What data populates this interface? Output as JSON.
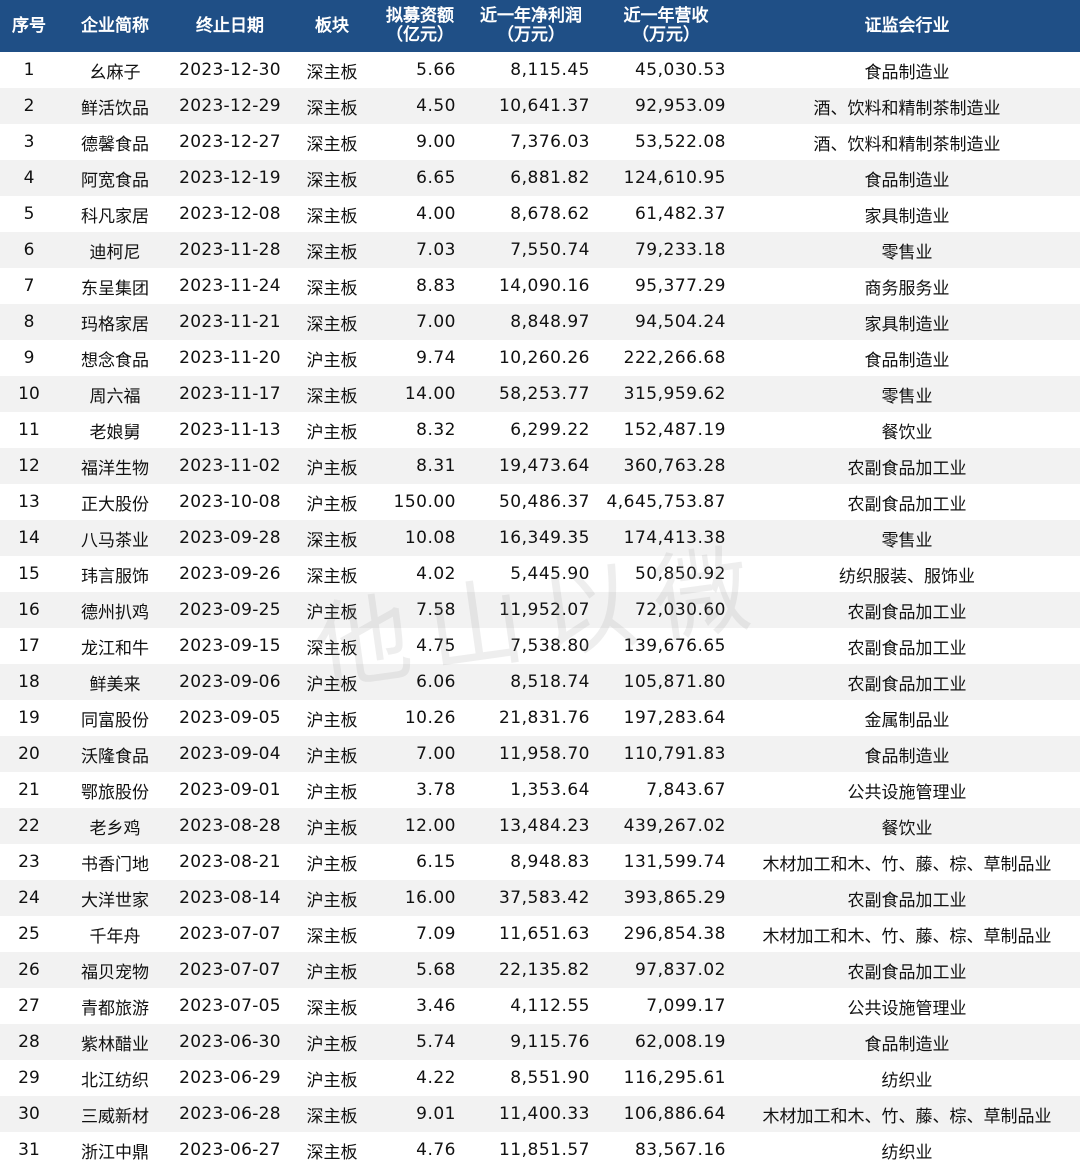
{
  "table": {
    "headers": [
      "序号",
      "企业简称",
      "终止日期",
      "板块",
      "拟募资额\n（亿元）",
      "近一年净利润\n（万元）",
      "近一年营收\n（万元）",
      "证监会行业"
    ],
    "rows": [
      [
        "1",
        "幺麻子",
        "2023-12-30",
        "深主板",
        "5.66",
        "8,115.45",
        "45,030.53",
        "食品制造业"
      ],
      [
        "2",
        "鲜活饮品",
        "2023-12-29",
        "深主板",
        "4.50",
        "10,641.37",
        "92,953.09",
        "酒、饮料和精制茶制造业"
      ],
      [
        "3",
        "德馨食品",
        "2023-12-27",
        "深主板",
        "9.00",
        "7,376.03",
        "53,522.08",
        "酒、饮料和精制茶制造业"
      ],
      [
        "4",
        "阿宽食品",
        "2023-12-19",
        "深主板",
        "6.65",
        "6,881.82",
        "124,610.95",
        "食品制造业"
      ],
      [
        "5",
        "科凡家居",
        "2023-12-08",
        "深主板",
        "4.00",
        "8,678.62",
        "61,482.37",
        "家具制造业"
      ],
      [
        "6",
        "迪柯尼",
        "2023-11-28",
        "深主板",
        "7.03",
        "7,550.74",
        "79,233.18",
        "零售业"
      ],
      [
        "7",
        "东呈集团",
        "2023-11-24",
        "深主板",
        "8.83",
        "14,090.16",
        "95,377.29",
        "商务服务业"
      ],
      [
        "8",
        "玛格家居",
        "2023-11-21",
        "深主板",
        "7.00",
        "8,848.97",
        "94,504.24",
        "家具制造业"
      ],
      [
        "9",
        "想念食品",
        "2023-11-20",
        "沪主板",
        "9.74",
        "10,260.26",
        "222,266.68",
        "食品制造业"
      ],
      [
        "10",
        "周六福",
        "2023-11-17",
        "深主板",
        "14.00",
        "58,253.77",
        "315,959.62",
        "零售业"
      ],
      [
        "11",
        "老娘舅",
        "2023-11-13",
        "沪主板",
        "8.32",
        "6,299.22",
        "152,487.19",
        "餐饮业"
      ],
      [
        "12",
        "福洋生物",
        "2023-11-02",
        "沪主板",
        "8.31",
        "19,473.64",
        "360,763.28",
        "农副食品加工业"
      ],
      [
        "13",
        "正大股份",
        "2023-10-08",
        "沪主板",
        "150.00",
        "50,486.37",
        "4,645,753.87",
        "农副食品加工业"
      ],
      [
        "14",
        "八马茶业",
        "2023-09-28",
        "深主板",
        "10.08",
        "16,349.35",
        "174,413.38",
        "零售业"
      ],
      [
        "15",
        "玮言服饰",
        "2023-09-26",
        "深主板",
        "4.02",
        "5,445.90",
        "50,850.92",
        "纺织服装、服饰业"
      ],
      [
        "16",
        "德州扒鸡",
        "2023-09-25",
        "沪主板",
        "7.58",
        "11,952.07",
        "72,030.60",
        "农副食品加工业"
      ],
      [
        "17",
        "龙江和牛",
        "2023-09-15",
        "深主板",
        "4.75",
        "7,538.80",
        "139,676.65",
        "农副食品加工业"
      ],
      [
        "18",
        "鲜美来",
        "2023-09-06",
        "沪主板",
        "6.06",
        "8,518.74",
        "105,871.80",
        "农副食品加工业"
      ],
      [
        "19",
        "同富股份",
        "2023-09-05",
        "沪主板",
        "10.26",
        "21,831.76",
        "197,283.64",
        "金属制品业"
      ],
      [
        "20",
        "沃隆食品",
        "2023-09-04",
        "沪主板",
        "7.00",
        "11,958.70",
        "110,791.83",
        "食品制造业"
      ],
      [
        "21",
        "鄂旅股份",
        "2023-09-01",
        "沪主板",
        "3.78",
        "1,353.64",
        "7,843.67",
        "公共设施管理业"
      ],
      [
        "22",
        "老乡鸡",
        "2023-08-28",
        "沪主板",
        "12.00",
        "13,484.23",
        "439,267.02",
        "餐饮业"
      ],
      [
        "23",
        "书香门地",
        "2023-08-21",
        "沪主板",
        "6.15",
        "8,948.83",
        "131,599.74",
        "木材加工和木、竹、藤、棕、草制品业"
      ],
      [
        "24",
        "大洋世家",
        "2023-08-14",
        "沪主板",
        "16.00",
        "37,583.42",
        "393,865.29",
        "农副食品加工业"
      ],
      [
        "25",
        "千年舟",
        "2023-07-07",
        "深主板",
        "7.09",
        "11,651.63",
        "296,854.38",
        "木材加工和木、竹、藤、棕、草制品业"
      ],
      [
        "26",
        "福贝宠物",
        "2023-07-07",
        "沪主板",
        "5.68",
        "22,135.82",
        "97,837.02",
        "农副食品加工业"
      ],
      [
        "27",
        "青都旅游",
        "2023-07-05",
        "深主板",
        "3.46",
        "4,112.55",
        "7,099.17",
        "公共设施管理业"
      ],
      [
        "28",
        "紫林醋业",
        "2023-06-30",
        "沪主板",
        "5.74",
        "9,115.76",
        "62,008.19",
        "食品制造业"
      ],
      [
        "29",
        "北江纺织",
        "2023-06-29",
        "沪主板",
        "4.22",
        "8,551.90",
        "116,295.61",
        "纺织业"
      ],
      [
        "30",
        "三威新材",
        "2023-06-28",
        "深主板",
        "9.01",
        "11,400.33",
        "106,886.64",
        "木材加工和木、竹、藤、棕、草制品业"
      ],
      [
        "31",
        "浙江中鼎",
        "2023-06-27",
        "深主板",
        "4.76",
        "11,851.57",
        "83,567.16",
        "纺织业"
      ]
    ]
  },
  "watermark": "他山以微",
  "colors": {
    "header_bg": "#1f4f86",
    "header_text": "#ffffff",
    "stripe": "#f2f2f2"
  }
}
